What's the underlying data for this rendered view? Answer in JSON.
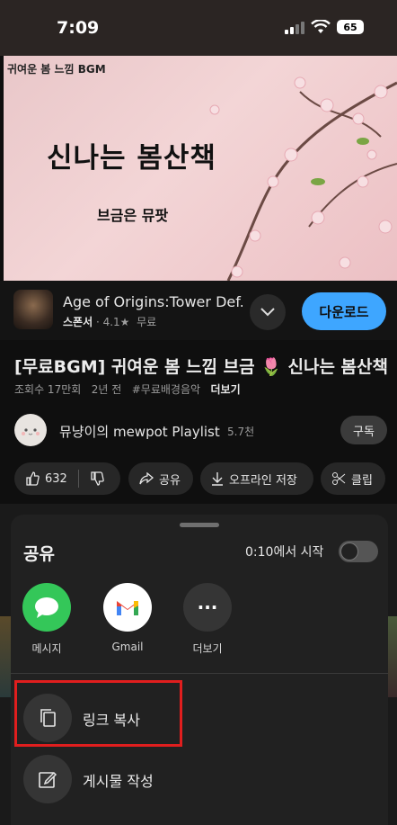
{
  "status_bar": {
    "time": "7:09",
    "battery": "65"
  },
  "video": {
    "overlay_small": "귀여운 봄 느낌 BGM",
    "overlay_title": "신나는 봄산책",
    "overlay_sub": "브금은 뮤팟"
  },
  "ad": {
    "title": "Age of Origins:Tower Def...",
    "sponsor": "스폰서",
    "rating": "4.1★",
    "price": "무료",
    "cta": "다운로드"
  },
  "video_info": {
    "title": "[무료BGM] 귀여운 봄 느낌 브금 🌷 신나는 봄산책",
    "views": "조회수 17만회",
    "age": "2년 전",
    "tag": "#무료배경음악",
    "more": "더보기"
  },
  "channel": {
    "name": "뮤냥이의 mewpot Playlist",
    "subscribers": "5.7천",
    "subscribe": "구독"
  },
  "actions": {
    "likes": "632",
    "share": "공유",
    "offline": "오프라인 저장",
    "clip": "클립"
  },
  "share_sheet": {
    "title": "공유",
    "start_at": "0:10에서 시작",
    "apps": [
      {
        "label": "메시지",
        "icon": "message-bubble-icon",
        "color": "#34c759"
      },
      {
        "label": "Gmail",
        "icon": "gmail-icon",
        "color": "#ffffff"
      },
      {
        "label": "더보기",
        "icon": "more-dots-icon",
        "color": "#353535"
      }
    ],
    "copy_link": "링크 복사",
    "create_post": "게시물 작성"
  }
}
